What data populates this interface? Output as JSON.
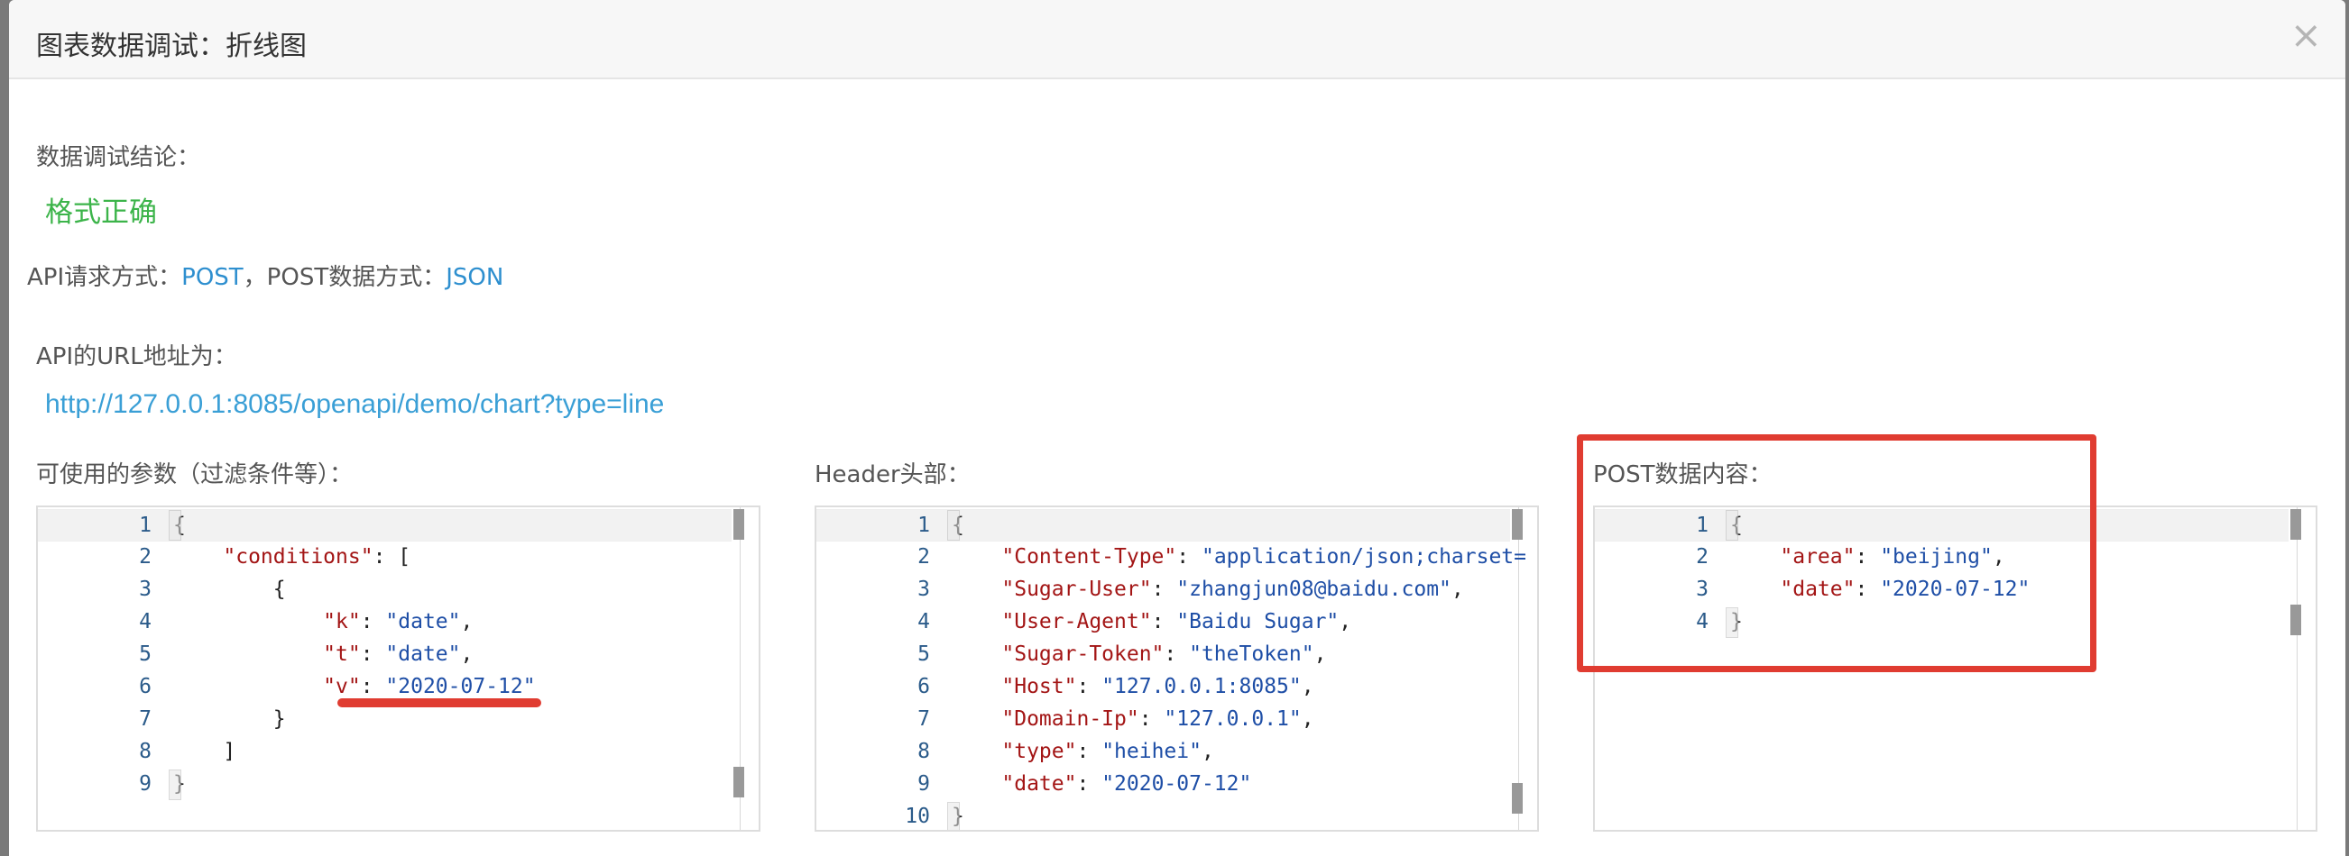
{
  "modal": {
    "title": "图表数据调试：折线图",
    "close_label": "×"
  },
  "result": {
    "label": "数据调试结论：",
    "value": "格式正确",
    "color": "#3cb44a"
  },
  "method": {
    "prefix": "API请求方式：",
    "method": "POST",
    "sep": "，POST数据方式：",
    "data_format": "JSON"
  },
  "url": {
    "label": "API的URL地址为：",
    "value": "http://127.0.0.1:8085/openapi/demo/chart?type=line"
  },
  "params_editor": {
    "label": "可使用的参数（过滤条件等）：",
    "lines": [
      {
        "n": "1",
        "html": "{"
      },
      {
        "n": "2",
        "html": "    <span class='k'>\"conditions\"</span>: ["
      },
      {
        "n": "3",
        "html": "        {"
      },
      {
        "n": "4",
        "html": "            <span class='k'>\"k\"</span>: <span class='s'>\"date\"</span>,"
      },
      {
        "n": "5",
        "html": "            <span class='k'>\"t\"</span>: <span class='s'>\"date\"</span>,"
      },
      {
        "n": "6",
        "html": "            <span class='k'>\"v\"</span>: <span class='s'>\"2020-07-12\"</span>"
      },
      {
        "n": "7",
        "html": "        }"
      },
      {
        "n": "8",
        "html": "    ]"
      },
      {
        "n": "9",
        "html": "}"
      }
    ]
  },
  "header_editor": {
    "label": "Header头部：",
    "lines": [
      {
        "n": "1",
        "html": "{"
      },
      {
        "n": "2",
        "html": "    <span class='k'>\"Content-Type\"</span>: <span class='s'>\"application/json;charset=</span>"
      },
      {
        "n": "3",
        "html": "    <span class='k'>\"Sugar-User\"</span>: <span class='s'>\"zhangjun08@baidu.com\"</span>,"
      },
      {
        "n": "4",
        "html": "    <span class='k'>\"User-Agent\"</span>: <span class='s'>\"Baidu Sugar\"</span>,"
      },
      {
        "n": "5",
        "html": "    <span class='k'>\"Sugar-Token\"</span>: <span class='s'>\"theToken\"</span>,"
      },
      {
        "n": "6",
        "html": "    <span class='k'>\"Host\"</span>: <span class='s'>\"127.0.0.1:8085\"</span>,"
      },
      {
        "n": "7",
        "html": "    <span class='k'>\"Domain-Ip\"</span>: <span class='s'>\"127.0.0.1\"</span>,"
      },
      {
        "n": "8",
        "html": "    <span class='k'>\"type\"</span>: <span class='s'>\"heihei\"</span>,"
      },
      {
        "n": "9",
        "html": "    <span class='k'>\"date\"</span>: <span class='s'>\"2020-07-12\"</span>"
      },
      {
        "n": "10",
        "html": "}"
      }
    ]
  },
  "post_editor": {
    "label": "POST数据内容：",
    "lines": [
      {
        "n": "1",
        "html": "{"
      },
      {
        "n": "2",
        "html": "    <span class='k'>\"area\"</span>: <span class='s'>\"beijing\"</span>,"
      },
      {
        "n": "3",
        "html": "    <span class='k'>\"date\"</span>: <span class='s'>\"2020-07-12\"</span>"
      },
      {
        "n": "4",
        "html": "}"
      }
    ]
  },
  "colors": {
    "accent_link": "#3a9fd6",
    "annotation_red": "#e03c31",
    "json_key": "#a31515",
    "json_string": "#1e4ea6"
  }
}
